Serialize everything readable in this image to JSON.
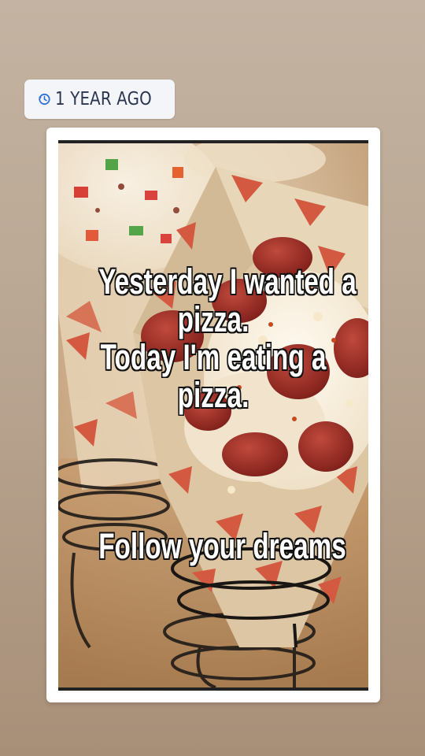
{
  "badge": {
    "icon": "clock-history-icon",
    "label": "1 YEAR AGO"
  },
  "post": {
    "image": "pizza-cone-photo",
    "caption_lines": {
      "line1": "Yesterday I wanted a",
      "line2": "pizza.",
      "line3": "Today I'm eating a",
      "line4": "pizza.",
      "line5": "Follow your dreams"
    }
  },
  "colors": {
    "badge_text": "#2a3550",
    "badge_icon": "#2e6fd8",
    "background": "#b9a692"
  }
}
